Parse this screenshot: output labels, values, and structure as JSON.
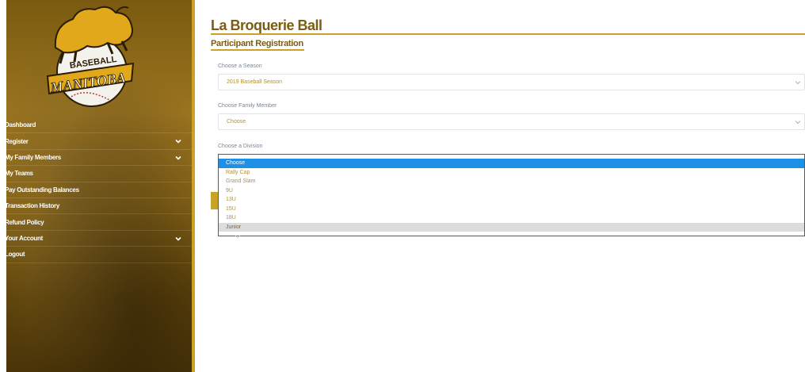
{
  "brand": {
    "logo_top": "BASEBALL",
    "logo_main": "MANITOBA"
  },
  "sidebar": {
    "items": [
      {
        "label": "Dashboard",
        "has_chevron": false
      },
      {
        "label": "Register",
        "has_chevron": true
      },
      {
        "label": "My Family Members",
        "has_chevron": true
      },
      {
        "label": "My Teams",
        "has_chevron": false
      },
      {
        "label": "Pay Outstanding Balances",
        "has_chevron": false
      },
      {
        "label": "Transaction History",
        "has_chevron": false
      },
      {
        "label": "Refund Policy",
        "has_chevron": false
      },
      {
        "label": "Your Account",
        "has_chevron": true
      },
      {
        "label": "Logout",
        "has_chevron": false
      }
    ]
  },
  "main": {
    "title": "La Broquerie Ball",
    "subtitle": "Participant Registration",
    "season": {
      "label": "Choose a Season",
      "value": "2019 Baseball Season"
    },
    "family_member": {
      "label": "Choose Family Member",
      "value": "Choose"
    },
    "division": {
      "label": "Choose a Division",
      "options": [
        "Choose",
        "Rally Cap",
        "Grand Slam",
        "9U",
        "13U",
        "15U",
        "18U",
        "Junior"
      ],
      "selected_index": 0,
      "hover_index": 7
    }
  },
  "colors": {
    "accent_gold": "#c9a227",
    "title_brown": "#7a5d10",
    "selected_blue": "#1e90e6"
  }
}
